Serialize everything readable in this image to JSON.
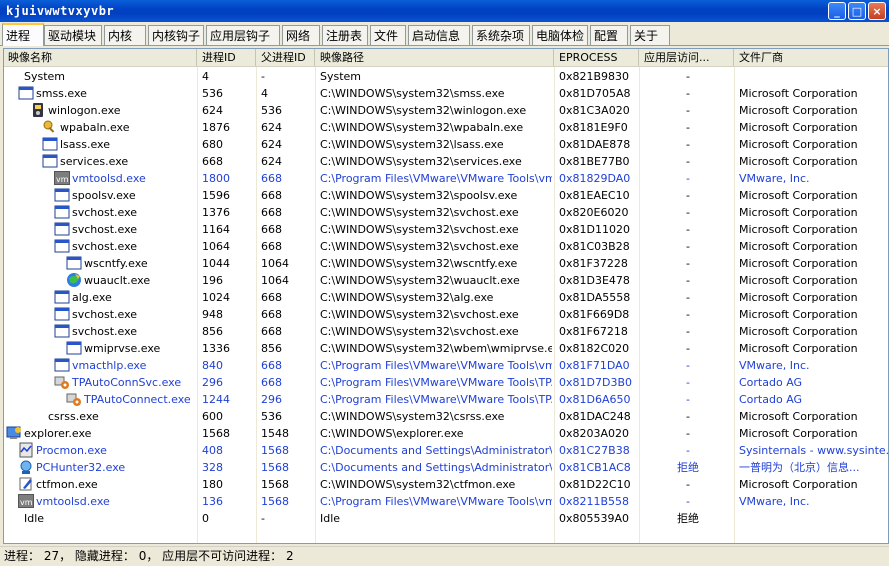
{
  "window": {
    "title": "kjuivwwtvxyvbr",
    "minimize": "_",
    "maximize": "□",
    "close": "×"
  },
  "tabs": [
    "进程",
    "驱动模块",
    "内核",
    "内核钩子",
    "应用层钩子",
    "网络",
    "注册表",
    "文件",
    "启动信息",
    "系统杂项",
    "电脑体检",
    "配置",
    "关于"
  ],
  "columns": [
    "映像名称",
    "进程ID",
    "父进程ID",
    "映像路径",
    "EPROCESS",
    "应用层访问...",
    "文件厂商"
  ],
  "rows": [
    {
      "name": "System",
      "pid": "4",
      "ppid": "-",
      "path": "System",
      "eprocess": "0x821B9830",
      "access": "-",
      "vendor": "",
      "indent": 1,
      "icon": "none-icon",
      "blue": false
    },
    {
      "name": "smss.exe",
      "pid": "536",
      "ppid": "4",
      "path": "C:\\WINDOWS\\system32\\smss.exe",
      "eprocess": "0x81D705A8",
      "access": "-",
      "vendor": "Microsoft Corporation",
      "indent": 2,
      "icon": "window-icon",
      "blue": false
    },
    {
      "name": "winlogon.exe",
      "pid": "624",
      "ppid": "536",
      "path": "C:\\WINDOWS\\system32\\winlogon.exe",
      "eprocess": "0x81C3A020",
      "access": "-",
      "vendor": "Microsoft Corporation",
      "indent": 3,
      "icon": "winlogon-icon",
      "blue": false
    },
    {
      "name": "wpabaln.exe",
      "pid": "1876",
      "ppid": "624",
      "path": "C:\\WINDOWS\\system32\\wpabaln.exe",
      "eprocess": "0x8181E9F0",
      "access": "-",
      "vendor": "Microsoft Corporation",
      "indent": 4,
      "icon": "key-icon",
      "blue": false
    },
    {
      "name": "lsass.exe",
      "pid": "680",
      "ppid": "624",
      "path": "C:\\WINDOWS\\system32\\lsass.exe",
      "eprocess": "0x81DAE878",
      "access": "-",
      "vendor": "Microsoft Corporation",
      "indent": 4,
      "icon": "window-icon",
      "blue": false
    },
    {
      "name": "services.exe",
      "pid": "668",
      "ppid": "624",
      "path": "C:\\WINDOWS\\system32\\services.exe",
      "eprocess": "0x81BE77B0",
      "access": "-",
      "vendor": "Microsoft Corporation",
      "indent": 4,
      "icon": "window-icon",
      "blue": false
    },
    {
      "name": "vmtoolsd.exe",
      "pid": "1800",
      "ppid": "668",
      "path": "C:\\Program Files\\VMware\\VMware Tools\\vmt...",
      "eprocess": "0x81829DA0",
      "access": "-",
      "vendor": "VMware, Inc.",
      "indent": 5,
      "icon": "vm-icon",
      "blue": true
    },
    {
      "name": "spoolsv.exe",
      "pid": "1596",
      "ppid": "668",
      "path": "C:\\WINDOWS\\system32\\spoolsv.exe",
      "eprocess": "0x81EAEC10",
      "access": "-",
      "vendor": "Microsoft Corporation",
      "indent": 5,
      "icon": "window-icon",
      "blue": false
    },
    {
      "name": "svchost.exe",
      "pid": "1376",
      "ppid": "668",
      "path": "C:\\WINDOWS\\system32\\svchost.exe",
      "eprocess": "0x820E6020",
      "access": "-",
      "vendor": "Microsoft Corporation",
      "indent": 5,
      "icon": "window-icon",
      "blue": false
    },
    {
      "name": "svchost.exe",
      "pid": "1164",
      "ppid": "668",
      "path": "C:\\WINDOWS\\system32\\svchost.exe",
      "eprocess": "0x81D11020",
      "access": "-",
      "vendor": "Microsoft Corporation",
      "indent": 5,
      "icon": "window-icon",
      "blue": false
    },
    {
      "name": "svchost.exe",
      "pid": "1064",
      "ppid": "668",
      "path": "C:\\WINDOWS\\system32\\svchost.exe",
      "eprocess": "0x81C03B28",
      "access": "-",
      "vendor": "Microsoft Corporation",
      "indent": 5,
      "icon": "window-icon",
      "blue": false
    },
    {
      "name": "wscntfy.exe",
      "pid": "1044",
      "ppid": "1064",
      "path": "C:\\WINDOWS\\system32\\wscntfy.exe",
      "eprocess": "0x81F37228",
      "access": "-",
      "vendor": "Microsoft Corporation",
      "indent": 6,
      "icon": "window-icon",
      "blue": false
    },
    {
      "name": "wuauclt.exe",
      "pid": "196",
      "ppid": "1064",
      "path": "C:\\WINDOWS\\system32\\wuauclt.exe",
      "eprocess": "0x81D3E478",
      "access": "-",
      "vendor": "Microsoft Corporation",
      "indent": 6,
      "icon": "globe-icon",
      "blue": false
    },
    {
      "name": "alg.exe",
      "pid": "1024",
      "ppid": "668",
      "path": "C:\\WINDOWS\\system32\\alg.exe",
      "eprocess": "0x81DA5558",
      "access": "-",
      "vendor": "Microsoft Corporation",
      "indent": 5,
      "icon": "window-icon",
      "blue": false
    },
    {
      "name": "svchost.exe",
      "pid": "948",
      "ppid": "668",
      "path": "C:\\WINDOWS\\system32\\svchost.exe",
      "eprocess": "0x81F669D8",
      "access": "-",
      "vendor": "Microsoft Corporation",
      "indent": 5,
      "icon": "window-icon",
      "blue": false
    },
    {
      "name": "svchost.exe",
      "pid": "856",
      "ppid": "668",
      "path": "C:\\WINDOWS\\system32\\svchost.exe",
      "eprocess": "0x81F67218",
      "access": "-",
      "vendor": "Microsoft Corporation",
      "indent": 5,
      "icon": "window-icon",
      "blue": false
    },
    {
      "name": "wmiprvse.exe",
      "pid": "1336",
      "ppid": "856",
      "path": "C:\\WINDOWS\\system32\\wbem\\wmiprvse.exe",
      "eprocess": "0x8182C020",
      "access": "-",
      "vendor": "Microsoft Corporation",
      "indent": 6,
      "icon": "window-icon",
      "blue": false
    },
    {
      "name": "vmacthlp.exe",
      "pid": "840",
      "ppid": "668",
      "path": "C:\\Program Files\\VMware\\VMware Tools\\vma...",
      "eprocess": "0x81F71DA0",
      "access": "-",
      "vendor": "VMware, Inc.",
      "indent": 5,
      "icon": "window-icon",
      "blue": true
    },
    {
      "name": "TPAutoConnSvc.exe",
      "pid": "296",
      "ppid": "668",
      "path": "C:\\Program Files\\VMware\\VMware Tools\\TPA...",
      "eprocess": "0x81D7D3B0",
      "access": "-",
      "vendor": "Cortado AG",
      "indent": 5,
      "icon": "connect-icon",
      "blue": true
    },
    {
      "name": "TPAutoConnect.exe",
      "pid": "1244",
      "ppid": "296",
      "path": "C:\\Program Files\\VMware\\VMware Tools\\TPA...",
      "eprocess": "0x81D6A650",
      "access": "-",
      "vendor": "Cortado AG",
      "indent": 6,
      "icon": "connect-icon",
      "blue": true
    },
    {
      "name": "csrss.exe",
      "pid": "600",
      "ppid": "536",
      "path": "C:\\WINDOWS\\system32\\csrss.exe",
      "eprocess": "0x81DAC248",
      "access": "-",
      "vendor": "Microsoft Corporation",
      "indent": 3,
      "icon": "none-icon",
      "blue": false
    },
    {
      "name": "explorer.exe",
      "pid": "1568",
      "ppid": "1548",
      "path": "C:\\WINDOWS\\explorer.exe",
      "eprocess": "0x8203A020",
      "access": "-",
      "vendor": "Microsoft Corporation",
      "indent": 1,
      "icon": "explorer-icon",
      "blue": false
    },
    {
      "name": "Procmon.exe",
      "pid": "408",
      "ppid": "1568",
      "path": "C:\\Documents and Settings\\Administrator\\桌...",
      "eprocess": "0x81C27B38",
      "access": "-",
      "vendor": "Sysinternals - www.sysinte...",
      "indent": 2,
      "icon": "procmon-icon",
      "blue": true
    },
    {
      "name": "PCHunter32.exe",
      "pid": "328",
      "ppid": "1568",
      "path": "C:\\Documents and Settings\\Administrator\\桌...",
      "eprocess": "0x81CB1AC8",
      "access": "拒绝",
      "vendor": "一普明为（北京）信息...",
      "indent": 2,
      "icon": "hunter-icon",
      "blue": true
    },
    {
      "name": "ctfmon.exe",
      "pid": "180",
      "ppid": "1568",
      "path": "C:\\WINDOWS\\system32\\ctfmon.exe",
      "eprocess": "0x81D22C10",
      "access": "-",
      "vendor": "Microsoft Corporation",
      "indent": 2,
      "icon": "pen-icon",
      "blue": false
    },
    {
      "name": "vmtoolsd.exe",
      "pid": "136",
      "ppid": "1568",
      "path": "C:\\Program Files\\VMware\\VMware Tools\\vmt...",
      "eprocess": "0x8211B558",
      "access": "-",
      "vendor": "VMware, Inc.",
      "indent": 2,
      "icon": "vm-icon",
      "blue": true
    },
    {
      "name": "Idle",
      "pid": "0",
      "ppid": "-",
      "path": "Idle",
      "eprocess": "0x805539A0",
      "access": "拒绝",
      "vendor": "",
      "indent": 1,
      "icon": "none-icon",
      "blue": false
    }
  ],
  "status": "进程： 27， 隐藏进程： 0， 应用层不可访问进程： 2"
}
